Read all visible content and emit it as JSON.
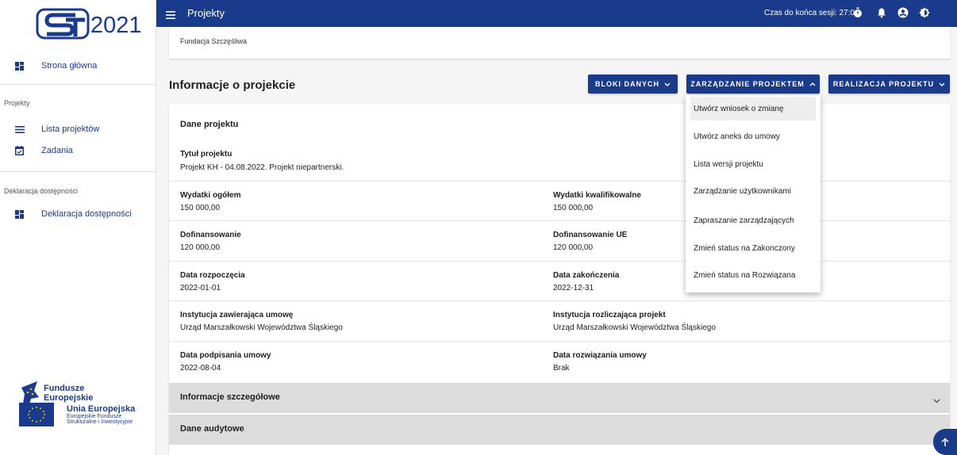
{
  "app": {
    "logo_text": "2021",
    "menu_title": "Projekty",
    "session_label": "Czas do końca sesji: 27:01"
  },
  "sidebar": {
    "home": "Strona główna",
    "section_projects": "Projekty",
    "projects_list": "Lista projektów",
    "tasks": "Zadania",
    "section_accessibility": "Deklaracja dostępności",
    "accessibility": "Deklaracja dostępności",
    "fe_logo_line1": "Fundusze",
    "fe_logo_line2": "Europejskie",
    "eu_logo_line1": "Unia Europejska",
    "eu_logo_line2": "Europejskie Fundusze",
    "eu_logo_line3": "Strukturalne i Inwestycyjne"
  },
  "top_card": {
    "org": "Fundacja Szczęśliwa"
  },
  "main": {
    "heading": "Informacje o projekcie",
    "btn_data_blocks": "BLOKI DANYCH",
    "btn_project_mgmt": "ZARZĄDZANIE PROJEKTEM",
    "btn_project_realization": "REALIZACJA PROJEKTU"
  },
  "card": {
    "title": "Dane projektu",
    "title_label": "Tytuł projektu",
    "title_value": "Projekt KH - 04.08.2022. Projekt niepartnerski.",
    "total_label": "Wydatki ogółem",
    "total_value": "150 000,00",
    "eligible_label": "Wydatki kwalifikowalne",
    "eligible_value": "150 000,00",
    "cofin_label": "Dofinansowanie",
    "cofin_value": "120 000,00",
    "cofin_eu_label": "Dofinansowanie UE",
    "cofin_eu_value": "120 000,00",
    "start_label": "Data rozpoczęcia",
    "start_value": "2022-01-01",
    "end_label": "Data zakończenia",
    "end_value": "2022-12-31",
    "inst_contract_label": "Instytucja zawierająca umowę",
    "inst_contract_value": "Urząd Marszałkowski Województwa Śląskiego",
    "inst_settle_label": "Instytucja rozliczająca projekt",
    "inst_settle_value": "Urząd Marszałkowski Województwa Śląskiego",
    "sign_label": "Data podpisania umowy",
    "sign_value": "2022-08-04",
    "termination_label": "Data rozwiązania umowy",
    "termination_value": "Brak"
  },
  "accordions": {
    "details": "Informacje szczegółowe",
    "audit": "Dane audytowe"
  },
  "dropdown": {
    "items": [
      "Utwórz wniosek o zmianę",
      "Utwórz aneks do umowy",
      "Lista wersji projektu",
      "Zarządzanie użytkownikami",
      "Zapraszanie zarządzających",
      "Zmień status na Zakonczony",
      "Zmień status na Rozwiązana"
    ]
  },
  "colors": {
    "primary": "#1a3b8c",
    "accordion": "#dcdcdc"
  }
}
